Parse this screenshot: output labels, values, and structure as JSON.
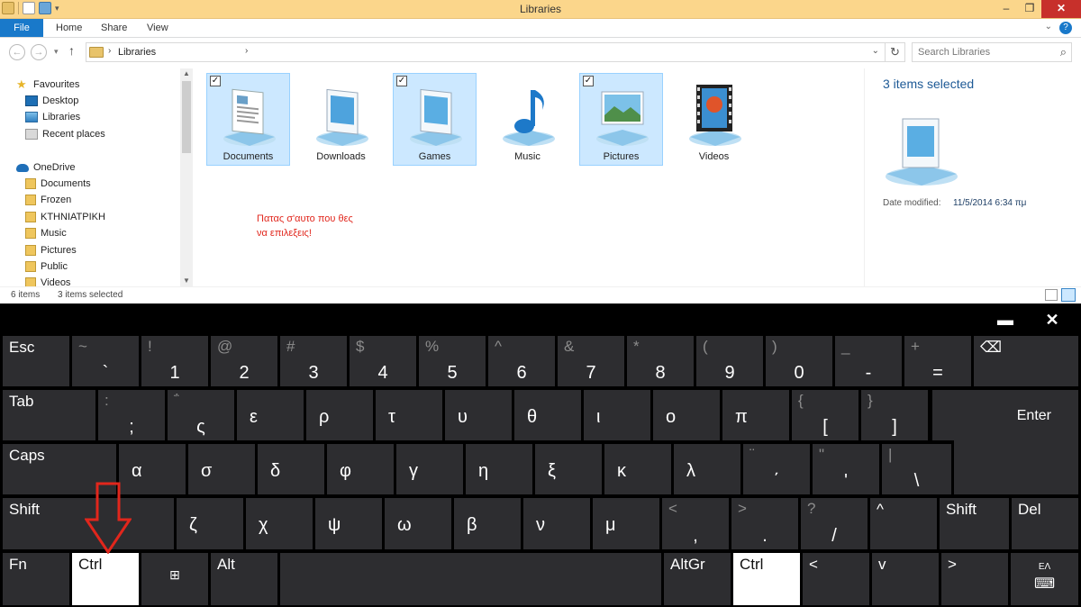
{
  "window": {
    "title": "Libraries"
  },
  "ribbon": {
    "tabs": [
      "File",
      "Home",
      "Share",
      "View"
    ],
    "help": "?"
  },
  "address": {
    "path": "Libraries",
    "search_placeholder": "Search Libraries"
  },
  "nav": {
    "favourites": {
      "label": "Favourites",
      "items": [
        "Desktop",
        "Libraries",
        "Recent places"
      ]
    },
    "onedrive": {
      "label": "OneDrive",
      "items": [
        "Documents",
        "Frozen",
        "ΚΤΗΝΙΑΤΡΙΚΗ",
        "Music",
        "Pictures",
        "Public",
        "Videos"
      ]
    }
  },
  "libraries": [
    {
      "name": "Documents",
      "selected": true,
      "checked": true
    },
    {
      "name": "Downloads",
      "selected": false,
      "checked": false
    },
    {
      "name": "Games",
      "selected": true,
      "checked": true
    },
    {
      "name": "Music",
      "selected": false,
      "checked": false
    },
    {
      "name": "Pictures",
      "selected": true,
      "checked": true
    },
    {
      "name": "Videos",
      "selected": false,
      "checked": false
    }
  ],
  "annotation": {
    "line1": "Πατας σ'αυτο που θες",
    "line2": "να επιλεξεις!"
  },
  "details": {
    "count": "3 items selected",
    "date_label": "Date modified:",
    "date_value": "11/5/2014 6:34 πμ"
  },
  "status": {
    "items": "6 items",
    "selected": "3 items selected"
  },
  "keyboard": {
    "row1": [
      {
        "top": "Esc",
        "bottom": ""
      },
      {
        "top": "~",
        "bottom": "`"
      },
      {
        "top": "!",
        "bottom": "1"
      },
      {
        "top": "@",
        "bottom": "2"
      },
      {
        "top": "#",
        "bottom": "3"
      },
      {
        "top": "$",
        "bottom": "4"
      },
      {
        "top": "%",
        "bottom": "5"
      },
      {
        "top": "^",
        "bottom": "6"
      },
      {
        "top": "&",
        "bottom": "7"
      },
      {
        "top": "*",
        "bottom": "8"
      },
      {
        "top": "(",
        "bottom": "9"
      },
      {
        "top": ")",
        "bottom": "0"
      },
      {
        "top": "_",
        "bottom": "-"
      },
      {
        "top": "+",
        "bottom": "="
      },
      {
        "top": "⌫",
        "bottom": ""
      }
    ],
    "row2": [
      {
        "top": "Tab",
        "bottom": ""
      },
      {
        "top": ":",
        "bottom": ";"
      },
      {
        "top": "΅",
        "bottom": "ς"
      },
      {
        "top": "ε",
        "bottom": ""
      },
      {
        "top": "ρ",
        "bottom": ""
      },
      {
        "top": "τ",
        "bottom": ""
      },
      {
        "top": "υ",
        "bottom": ""
      },
      {
        "top": "θ",
        "bottom": ""
      },
      {
        "top": "ι",
        "bottom": ""
      },
      {
        "top": "ο",
        "bottom": ""
      },
      {
        "top": "π",
        "bottom": ""
      },
      {
        "top": "{",
        "bottom": "["
      },
      {
        "top": "}",
        "bottom": "]"
      },
      {
        "top": "Enter",
        "bottom": ""
      }
    ],
    "row3": [
      {
        "top": "Caps",
        "bottom": ""
      },
      {
        "top": "α",
        "bottom": ""
      },
      {
        "top": "σ",
        "bottom": ""
      },
      {
        "top": "δ",
        "bottom": ""
      },
      {
        "top": "φ",
        "bottom": ""
      },
      {
        "top": "γ",
        "bottom": ""
      },
      {
        "top": "η",
        "bottom": ""
      },
      {
        "top": "ξ",
        "bottom": ""
      },
      {
        "top": "κ",
        "bottom": ""
      },
      {
        "top": "λ",
        "bottom": ""
      },
      {
        "top": "¨",
        "bottom": "΄"
      },
      {
        "top": "\"",
        "bottom": "'"
      },
      {
        "top": "|",
        "bottom": "\\"
      }
    ],
    "row4": [
      {
        "top": "Shift",
        "bottom": ""
      },
      {
        "top": "ζ",
        "bottom": ""
      },
      {
        "top": "χ",
        "bottom": ""
      },
      {
        "top": "ψ",
        "bottom": ""
      },
      {
        "top": "ω",
        "bottom": ""
      },
      {
        "top": "β",
        "bottom": ""
      },
      {
        "top": "ν",
        "bottom": ""
      },
      {
        "top": "μ",
        "bottom": ""
      },
      {
        "top": "<",
        "bottom": ","
      },
      {
        "top": ">",
        "bottom": "."
      },
      {
        "top": "?",
        "bottom": "/"
      },
      {
        "top": "^",
        "bottom": ""
      },
      {
        "top": "Shift",
        "bottom": ""
      },
      {
        "top": "Del",
        "bottom": ""
      }
    ],
    "row5": [
      {
        "top": "Fn",
        "bottom": ""
      },
      {
        "top": "Ctrl",
        "bottom": ""
      },
      {
        "top": "⊞",
        "bottom": ""
      },
      {
        "top": "Alt",
        "bottom": ""
      },
      {
        "top": "",
        "bottom": ""
      },
      {
        "top": "AltGr",
        "bottom": ""
      },
      {
        "top": "Ctrl",
        "bottom": ""
      },
      {
        "top": "<",
        "bottom": ""
      },
      {
        "top": "v",
        "bottom": ""
      },
      {
        "top": ">",
        "bottom": ""
      },
      {
        "top": "ΕΛ",
        "bottom": ""
      }
    ],
    "minimize": "▬",
    "close": "✕"
  },
  "colors": {
    "titlebar": "#fbd68b",
    "selection": "#cce8ff",
    "accent": "#1979ca",
    "annotation": "#e1261c",
    "key": "#2d2d30",
    "highlight_key": "#ffffff"
  }
}
